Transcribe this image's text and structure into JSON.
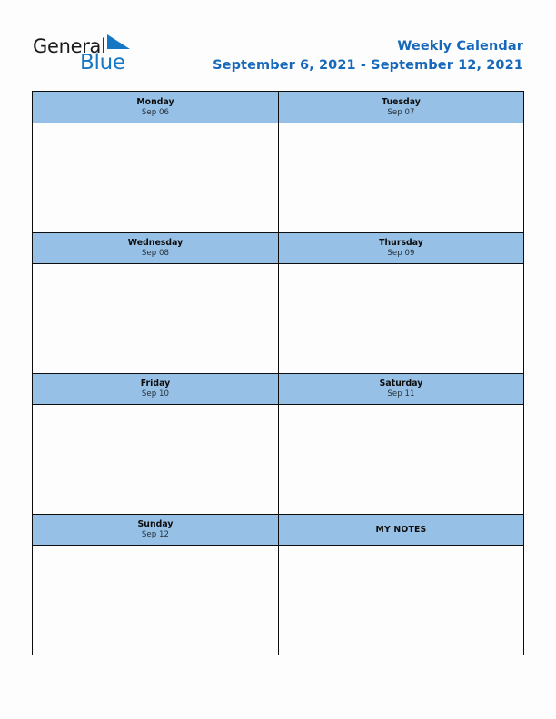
{
  "brand": {
    "name_part1": "General",
    "name_part2": "Blue",
    "flag_icon": "blue-triangle-flag-icon"
  },
  "header": {
    "title": "Weekly Calendar",
    "date_range": "September 6, 2021 - September 12, 2021"
  },
  "colors": {
    "header_blue": "#96c0e5",
    "title_blue": "#1668bb",
    "brand_blue": "#1577c4",
    "border": "#0d0d0d",
    "cell_background": "#fdfdfd"
  },
  "calendar": {
    "rows": [
      {
        "left": {
          "kind": "day",
          "day": "Monday",
          "date": "Sep 06",
          "note": ""
        },
        "right": {
          "kind": "day",
          "day": "Tuesday",
          "date": "Sep 07",
          "note": ""
        }
      },
      {
        "left": {
          "kind": "day",
          "day": "Wednesday",
          "date": "Sep 08",
          "note": ""
        },
        "right": {
          "kind": "day",
          "day": "Thursday",
          "date": "Sep 09",
          "note": ""
        }
      },
      {
        "left": {
          "kind": "day",
          "day": "Friday",
          "date": "Sep 10",
          "note": ""
        },
        "right": {
          "kind": "day",
          "day": "Saturday",
          "date": "Sep 11",
          "note": ""
        }
      },
      {
        "left": {
          "kind": "day",
          "day": "Sunday",
          "date": "Sep 12",
          "note": ""
        },
        "right": {
          "kind": "notes",
          "day": "MY NOTES",
          "date": "",
          "note": ""
        }
      }
    ]
  }
}
